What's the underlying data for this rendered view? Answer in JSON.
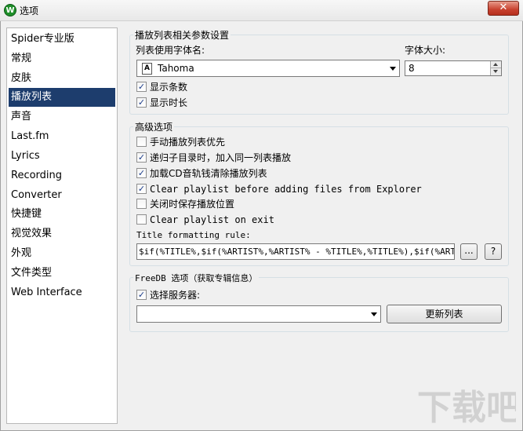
{
  "window": {
    "title": "选项",
    "app_icon": "W"
  },
  "sidebar": {
    "items": [
      {
        "label": "Spider专业版",
        "selected": false
      },
      {
        "label": "常规",
        "selected": false
      },
      {
        "label": "皮肤",
        "selected": false
      },
      {
        "label": "播放列表",
        "selected": true
      },
      {
        "label": "声音",
        "selected": false
      },
      {
        "label": "Last.fm",
        "selected": false
      },
      {
        "label": "Lyrics",
        "selected": false
      },
      {
        "label": "Recording",
        "selected": false
      },
      {
        "label": "Converter",
        "selected": false
      },
      {
        "label": "快捷键",
        "selected": false
      },
      {
        "label": "视觉效果",
        "selected": false
      },
      {
        "label": "外观",
        "selected": false
      },
      {
        "label": "文件类型",
        "selected": false
      },
      {
        "label": "Web Interface",
        "selected": false
      }
    ]
  },
  "playlist_settings": {
    "legend": "播放列表相关参数设置",
    "font_label": "列表使用字体名:",
    "font_value": "Tahoma",
    "size_label": "字体大小:",
    "size_value": "8",
    "show_count": {
      "label": "显示条数",
      "checked": true
    },
    "show_duration": {
      "label": "显示时长",
      "checked": true
    }
  },
  "advanced": {
    "legend": "高级选项",
    "options": [
      {
        "label": "手动播放列表优先",
        "checked": false
      },
      {
        "label": "递归子目录时，加入同一列表播放",
        "checked": true
      },
      {
        "label": "加载CD音轨钱清除播放列表",
        "checked": true
      },
      {
        "label": "Clear playlist before adding files from Explorer",
        "checked": true
      },
      {
        "label": "关闭时保存播放位置",
        "checked": false
      },
      {
        "label": "Clear playlist on exit",
        "checked": false
      }
    ],
    "title_rule_label": "Title formatting rule:",
    "title_rule_value": "$if(%TITLE%,$if(%ARTIST%,%ARTIST% - %TITLE%,%TITLE%),$if(%ARTIST%,%",
    "ellipsis_button": "...",
    "help_button": "?"
  },
  "freedb": {
    "legend": "FreeDB 选项（获取专辑信息）",
    "select_server": {
      "label": "选择服务器:",
      "checked": true
    },
    "server_value": "",
    "refresh_button": "更新列表"
  },
  "watermark": {
    "text": "下载吧"
  },
  "colors": {
    "selection": "#1d3d6d",
    "close": "#c8412f",
    "check": "#1b3c8a"
  }
}
